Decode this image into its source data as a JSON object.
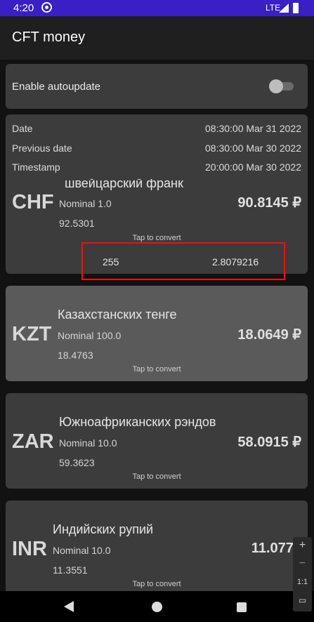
{
  "status_bar": {
    "time": "4:20",
    "network": "LTE"
  },
  "app_bar": {
    "title": "CFT money"
  },
  "autoupdate": {
    "label": "Enable autoupdate",
    "enabled": false
  },
  "info": {
    "rows": [
      {
        "label": "Date",
        "value": "08:30:00 Mar 31 2022"
      },
      {
        "label": "Previous date",
        "value": "08:30:00 Mar 30 2022"
      },
      {
        "label": "Timestamp",
        "value": "20:00:00 Mar 30 2022"
      }
    ]
  },
  "currencies": [
    {
      "code": "CHF",
      "name": "швейцарский франк",
      "nominal": "Nominal 1.0",
      "previous": "92.5301",
      "rate": "90.8145 ₽",
      "tap": "Tap to convert",
      "converter": {
        "input": "255",
        "result": "2.8079216"
      }
    },
    {
      "code": "KZT",
      "name": "Казахстанских тенге",
      "nominal": "Nominal 100.0",
      "previous": "18.4763",
      "rate": "18.0649 ₽",
      "tap": "Tap to convert"
    },
    {
      "code": "ZAR",
      "name": "Южноафриканских рэндов",
      "nominal": "Nominal 10.0",
      "previous": "59.3623",
      "rate": "58.0915 ₽",
      "tap": "Tap to convert"
    },
    {
      "code": "INR",
      "name": "Индийских рупий",
      "nominal": "Nominal 10.0",
      "previous": "11.3551",
      "rate": "11.0773",
      "tap": "Tap to convert"
    }
  ],
  "zoom_controls": {
    "zoom_in": "+",
    "zoom_out": "−",
    "reset": "1:1"
  },
  "colors": {
    "status_bar": "#3a1fc4",
    "card": "#3c3c3c",
    "card_highlight": "#5a5a5a",
    "annotation": "#ee1111"
  }
}
